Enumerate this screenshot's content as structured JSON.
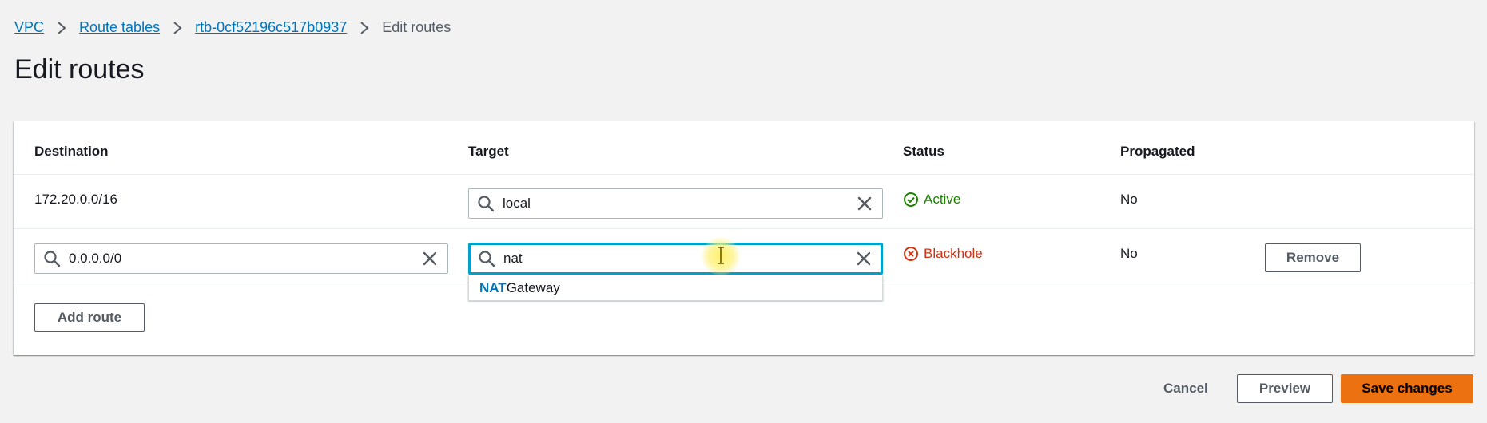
{
  "breadcrumb": {
    "items": [
      "VPC",
      "Route tables",
      "rtb-0cf52196c517b0937"
    ],
    "current": "Edit routes"
  },
  "page_title": "Edit routes",
  "table": {
    "headers": {
      "destination": "Destination",
      "target": "Target",
      "status": "Status",
      "propagated": "Propagated"
    },
    "rows": [
      {
        "destination": "172.20.0.0/16",
        "target": "local",
        "status": "Active",
        "propagated": "No"
      },
      {
        "destination": "0.0.0.0/0",
        "target": "nat",
        "status": "Blackhole",
        "propagated": "No",
        "remove_label": "Remove"
      }
    ],
    "dropdown": {
      "match": "NAT",
      "rest": " Gateway"
    },
    "add_route_label": "Add route"
  },
  "footer": {
    "cancel_label": "Cancel",
    "preview_label": "Preview",
    "save_label": "Save changes"
  },
  "icons": {
    "search": "search-icon",
    "clear": "close-icon",
    "active": "check-circle-icon",
    "blackhole": "x-circle-icon"
  },
  "colors": {
    "link": "#0073bb",
    "active": "#1d8102",
    "blackhole": "#d13212",
    "primary": "#ec7211",
    "focus": "#00a1c9"
  }
}
